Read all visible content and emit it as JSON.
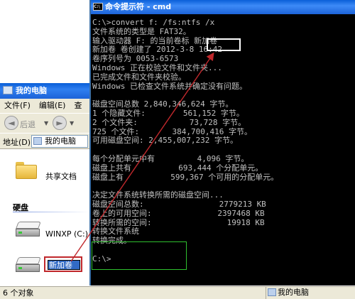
{
  "explorer": {
    "title": "我的电脑",
    "menu": [
      "文件(F)",
      "编辑(E)",
      "查"
    ],
    "toolbar": {
      "back_label": "后退"
    },
    "address_label": "地址(D)",
    "address_value": "我的电脑",
    "shared_folder_label": "共享文档",
    "section_hard_disks": "硬盘",
    "drive1_label": "WINXP (C:)",
    "drive2_rename_value": "新加卷",
    "status_left": "6 个对象",
    "status_right": "我的电脑"
  },
  "cmd": {
    "title": "命令提示符 - cmd",
    "lines": [
      "C:\\>convert f: /fs:ntfs /x",
      "文件系统的类型是 FAT32。",
      "输入驱动器 F: 的当前卷标 新加卷",
      "新加卷 卷创建了 2012-3-8 16:42",
      "卷序列号为 0053-6573",
      "Windows 正在校验文件和文件夹...",
      "已完成文件和文件夹校验。",
      "Windows 已检查文件系统并确定没有问题。",
      "",
      "磁盘空间总数 2,840,346,624 字节。",
      "1 个隐藏文件:        561,152 字节。",
      "2 个文件夹:           73,728 字节。",
      "725 个文件:       384,700,416 字节。",
      "可用磁盘空间: 2,455,007,232 字节。",
      "",
      "每个分配单元中有         4,096 字节。",
      "磁盘上共有          693,444 个分配单元。",
      "磁盘上有          599,367 个可用的分配单元。",
      "",
      "决定文件系统转换所需的磁盘空间...",
      "磁盘空间总数:                2779213 KB",
      "卷上的可用空间:              2397468 KB",
      "转换所需的空间:                19918 KB",
      "转换文件系统",
      "转换完成。",
      "",
      "C:\\>"
    ]
  },
  "colors": {
    "highlight_red": "#c0282c",
    "highlight_green": "#2fc02f",
    "title_blue": "#0a5fd8"
  }
}
